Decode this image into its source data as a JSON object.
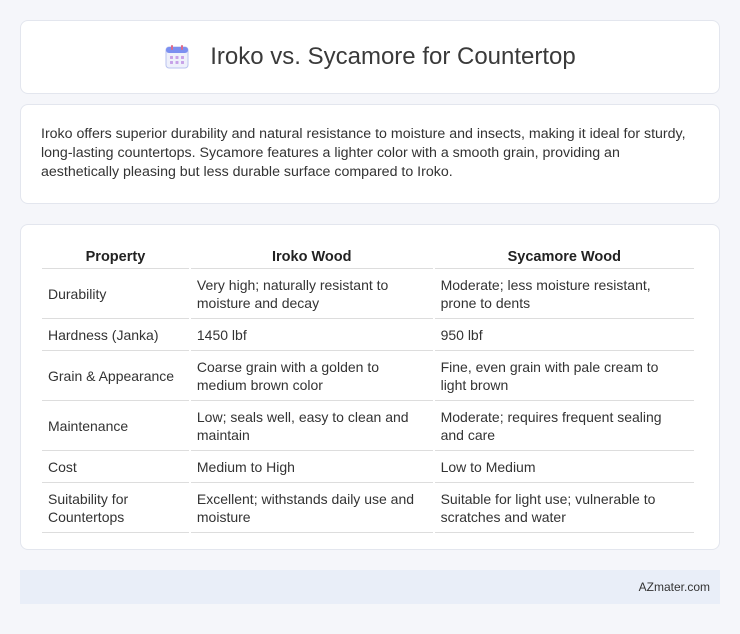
{
  "header": {
    "icon": "calendar-icon",
    "title": "Iroko vs. Sycamore for Countertop"
  },
  "intro": {
    "text": "Iroko offers superior durability and natural resistance to moisture and insects, making it ideal for sturdy, long-lasting countertops. Sycamore features a lighter color with a smooth grain, providing an aesthetically pleasing but less durable surface compared to Iroko."
  },
  "table": {
    "headers": [
      "Property",
      "Iroko Wood",
      "Sycamore Wood"
    ],
    "rows": [
      [
        "Durability",
        "Very high; naturally resistant to moisture and decay",
        "Moderate; less moisture resistant, prone to dents"
      ],
      [
        "Hardness (Janka)",
        "1450 lbf",
        "950 lbf"
      ],
      [
        "Grain & Appearance",
        "Coarse grain with a golden to medium brown color",
        "Fine, even grain with pale cream to light brown"
      ],
      [
        "Maintenance",
        "Low; seals well, easy to clean and maintain",
        "Moderate; requires frequent sealing and care"
      ],
      [
        "Cost",
        "Medium to High",
        "Low to Medium"
      ],
      [
        "Suitability for Countertops",
        "Excellent; withstands daily use and moisture",
        "Suitable for light use; vulnerable to scratches and water"
      ]
    ]
  },
  "footer": {
    "brand": "AZmater.com"
  },
  "colors": {
    "background": "#f5f6fa",
    "footer_bg": "#e9eef8",
    "icon_accent": "#7b8ff0"
  }
}
